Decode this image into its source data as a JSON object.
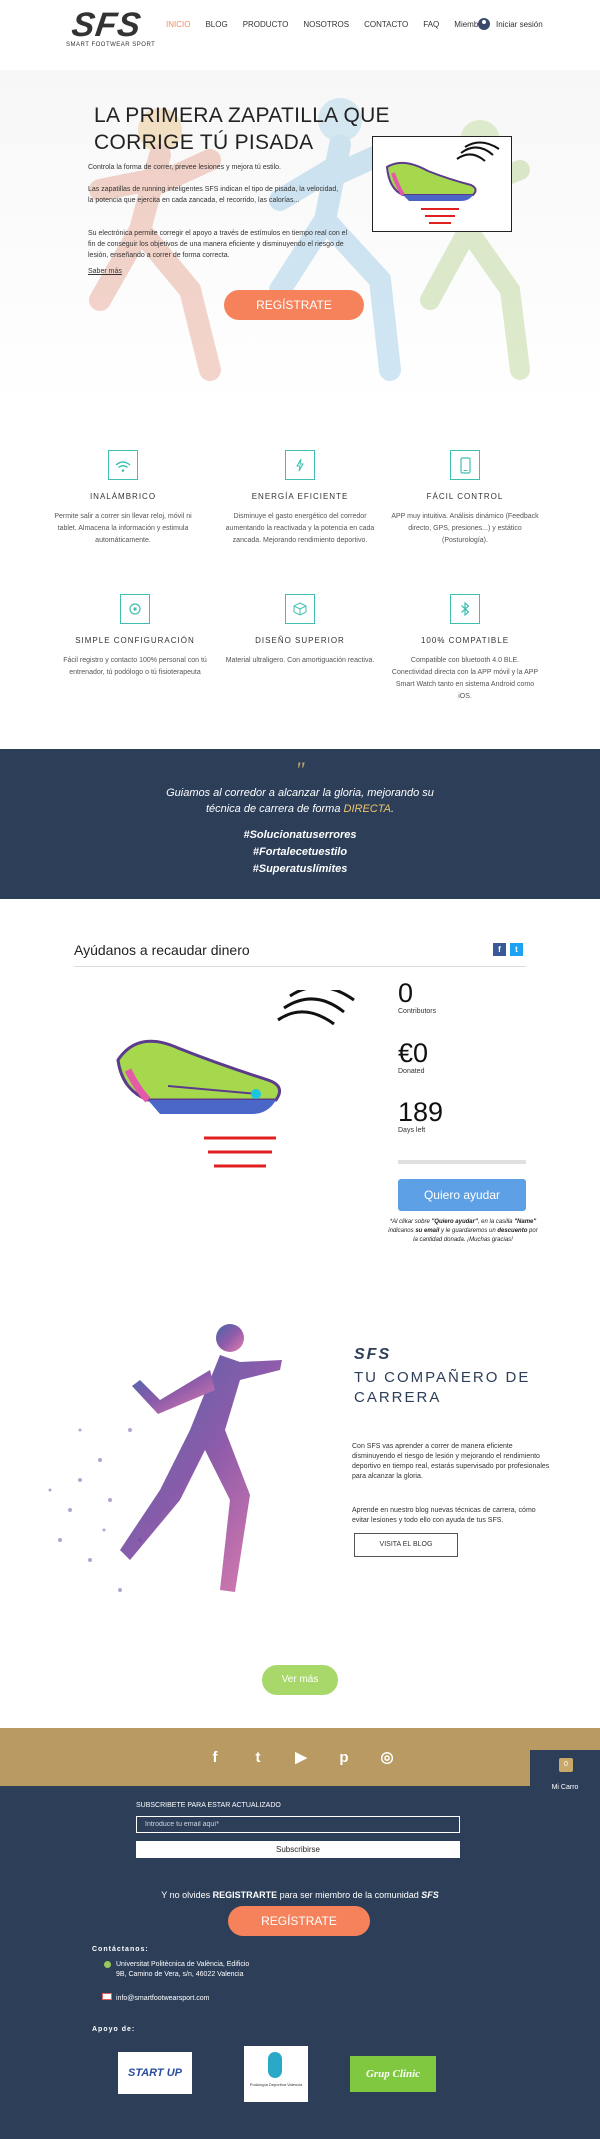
{
  "header": {
    "logo": "SFS",
    "logo_sub": "SMART FOOTWEAR SPORT",
    "nav": [
      "INICIO",
      "BLOG",
      "PRODUCTO",
      "NOSOTROS",
      "CONTACTO",
      "FAQ",
      "Miembros"
    ],
    "login": "Iniciar sesión"
  },
  "hero": {
    "title": "LA PRIMERA ZAPATILLA QUE CORRIGE TÚ PISADA",
    "subtitle": "Controla la forma de correr, prevee lesiones y mejora tú estilo.",
    "p1": "Las zapatillas de running inteligentes SFS indican el tipo de pisada, la velocidad, la potencia que ejercita en cada zancada, el recorrido, las calorías...",
    "p2": "Su electrónica permite corregir el apoyo a través de estímulos en tiempo real con el fin de conseguir los objetivos de una manera eficiente y disminuyendo el riesgo de lesión, enseñando a correr de forma correcta.",
    "more": "Saber más",
    "cta": "REGÍSTRATE"
  },
  "features": [
    {
      "icon": "wifi-icon",
      "title": "INALÁMBRICO",
      "desc": "Permite salir a correr sin llevar reloj, móvil ni tablet. Almacena la información y estimula automáticamente."
    },
    {
      "icon": "lightning-icon",
      "title": "ENERGÍA EFICIENTE",
      "desc": "Disminuye el gasto energético del corredor aumentando la reactivada y la potencia en cada zancada. Mejorando rendimiento deportivo."
    },
    {
      "icon": "phone-icon",
      "title": "FÁCIL CONTROL",
      "desc": "APP muy intuitiva. Análisis dinámico (Feedback directo, GPS, presiones...) y estático (Posturología)."
    },
    {
      "icon": "settings-icon",
      "title": "SIMPLE CONFIGURACIÓN",
      "desc": "Fácil registro y contacto 100% personal con tú entrenador, tú podólogo o tú fisioterapeuta"
    },
    {
      "icon": "cube-icon",
      "title": "DISEÑO SUPERIOR",
      "desc": "Material ultraligero. Con amortiguación reactiva."
    },
    {
      "icon": "bluetooth-icon",
      "title": "100% COMPATIBLE",
      "desc": "Compatible con bluetooth 4.0 BLE. Conectividad directa con la APP móvil y la APP Smart Watch tanto en sistema Android como iOS."
    }
  ],
  "quote": {
    "mark": "\"",
    "line1": "Guiamos al corredor a alcanzar la gloria, mejorando su",
    "line2_a": "técnica de carrera de forma ",
    "line2_hl": "DIRECTA",
    "line2_b": ".",
    "tags": [
      "#Solucionatuserrores",
      "#Fortalecetuestilo",
      "#Superatuslímites"
    ]
  },
  "fundraise": {
    "title": "Ayúdanos a recaudar dinero",
    "contributors_value": "0",
    "contributors_label": "Contributors",
    "donated_value": "€0",
    "donated_label": "Donated",
    "days_value": "189",
    "days_label": "Days left",
    "progress": 0,
    "button": "Quiero ayudar",
    "note_1": "*Al clikar sobre ",
    "note_b1": "\"Quiero ayudar\"",
    "note_2": ", en la casilla ",
    "note_b2": "\"Name\"",
    "note_3": " indicanos ",
    "note_b3": "su email",
    "note_4": " y le guardaremos un ",
    "note_b4": "descuento",
    "note_5": " por la cantidad donada. ¡Muchas gracias!"
  },
  "companion": {
    "brand": "SFS",
    "title": "TU COMPAÑERO DE CARRERA",
    "p1": "Con SFS vas aprender a correr de manera eficiente disminuyendo el riesgo de lesión y mejorando el rendimiento deportivo en tiempo real, estarás supervisado por profesionales para alcanzar la gloria.",
    "p2": "Aprende en nuestro blog nuevas técnicas de carrera, cómo evitar lesiones y todo ello con ayuda de tus SFS.",
    "blog_button": "VISITA EL BLOG",
    "more_button": "Ver más"
  },
  "social": [
    "f",
    "t",
    "▶",
    "p",
    "◎"
  ],
  "cart": {
    "count": "0",
    "label": "Mi Carro"
  },
  "footer": {
    "subscribe_title": "SUBSCRIBETE PARA ESTAR ACTUALIZADO",
    "email_placeholder": "Introduce tu email aquí*",
    "subscribe_button": "Subscribirse",
    "join_a": "Y no olvides ",
    "join_b": "REGISTRARTE",
    "join_c": " para ser miembro de la comunidad ",
    "join_d": "SFS",
    "cta": "REGÍSTRATE",
    "contact_title": "Contáctanos:",
    "address_1": "Universitat Politècnica de València, Edificio",
    "address_2": "9B, Camino de Vera, s/n, 46022 Valencia",
    "email": "info@smartfootwearsport.com",
    "support_title": "Apoyo de:",
    "sponsors": [
      "START UP",
      "Podología Deportiva Valencia",
      "Grup Clinic"
    ]
  },
  "colors": {
    "accent": "#f5825b",
    "navy": "#2c3e58",
    "teal": "#3fbfb0",
    "gold": "#b89a62",
    "blue": "#5ea0e6",
    "green": "#a9d86a"
  }
}
